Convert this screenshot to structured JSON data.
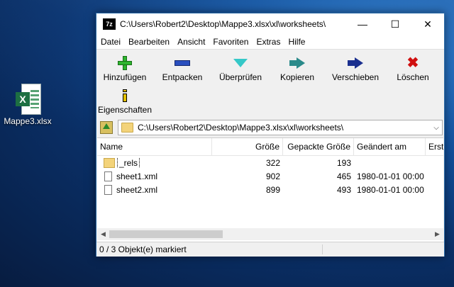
{
  "desktop": {
    "icon_label": "Mappe3.xlsx",
    "icon_badge": "X"
  },
  "window": {
    "app_icon": "7z",
    "title": "C:\\Users\\Robert2\\Desktop\\Mappe3.xlsx\\xl\\worksheets\\",
    "controls": {
      "minimize": "—",
      "maximize": "☐",
      "close": "✕"
    }
  },
  "menu": [
    "Datei",
    "Bearbeiten",
    "Ansicht",
    "Favoriten",
    "Extras",
    "Hilfe"
  ],
  "toolbar": {
    "add": "Hinzufügen",
    "extract": "Entpacken",
    "test": "Überprüfen",
    "copy": "Kopieren",
    "move": "Verschieben",
    "delete": "Löschen",
    "info": "Eigenschaften"
  },
  "address": {
    "path": "C:\\Users\\Robert2\\Desktop\\Mappe3.xlsx\\xl\\worksheets\\",
    "dropdown": "⌵"
  },
  "columns": {
    "name": "Name",
    "size": "Größe",
    "packed": "Gepackte Größe",
    "modified": "Geändert am",
    "created": "Erst"
  },
  "files": [
    {
      "name": "_rels",
      "type": "folder",
      "size": "322",
      "packed": "193",
      "modified": ""
    },
    {
      "name": "sheet1.xml",
      "type": "file",
      "size": "902",
      "packed": "465",
      "modified": "1980-01-01 00:00"
    },
    {
      "name": "sheet2.xml",
      "type": "file",
      "size": "899",
      "packed": "493",
      "modified": "1980-01-01 00:00"
    }
  ],
  "status": "0 / 3 Objekt(e) markiert",
  "colors": {
    "add": "#2fb52f",
    "extract": "#2a4fbf",
    "test": "#35c8c8",
    "copy": "#2a8a8a",
    "move": "#1a2f8f",
    "delete": "#d01010"
  }
}
